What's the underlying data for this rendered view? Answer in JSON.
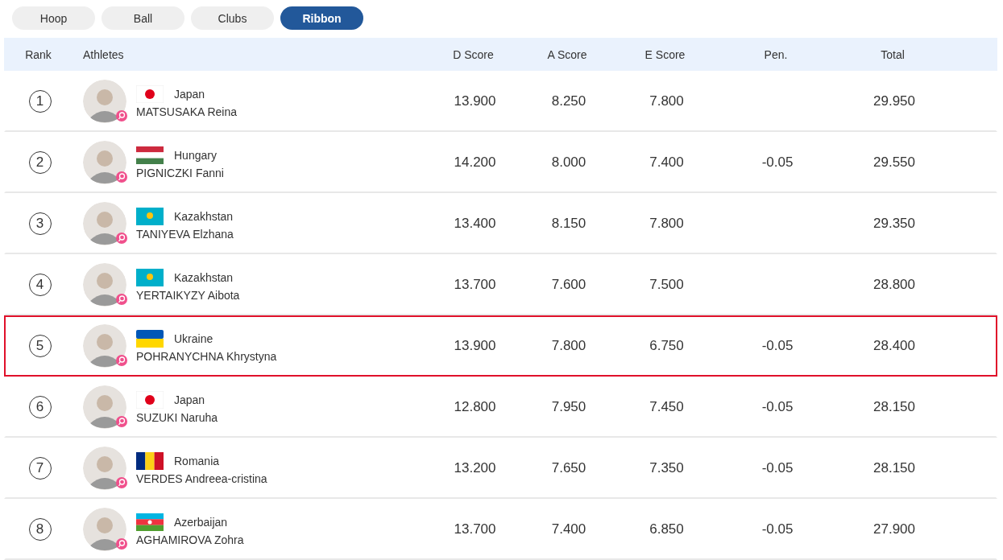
{
  "tabs": [
    {
      "label": "Hoop",
      "selected": false
    },
    {
      "label": "Ball",
      "selected": false
    },
    {
      "label": "Clubs",
      "selected": false
    },
    {
      "label": "Ribbon",
      "selected": true
    }
  ],
  "table": {
    "columns": [
      "Rank",
      "Athletes",
      "D Score",
      "A Score",
      "E Score",
      "Pen.",
      "Total"
    ],
    "rows": [
      {
        "rank": "1",
        "country": "Japan",
        "flag": {
          "kind": "japan"
        },
        "name": "MATSUSAKA Reina",
        "d_score": "13.900",
        "a_score": "8.250",
        "e_score": "7.800",
        "total": "29.950",
        "selected": false
      },
      {
        "rank": "2",
        "country": "Hungary",
        "flag": {
          "kind": "hungary"
        },
        "name": "PIGNICZKI Fanni",
        "d_score": "14.200",
        "a_score": "8.000",
        "e_score": "7.400",
        "penalty": "-0.05",
        "total": "29.550",
        "selected": false
      },
      {
        "rank": "3",
        "country": "Kazakhstan",
        "flag": {
          "kind": "kazakhstan"
        },
        "name": "TANIYEVA Elzhana",
        "d_score": "13.400",
        "a_score": "8.150",
        "e_score": "7.800",
        "total": "29.350",
        "selected": false
      },
      {
        "rank": "4",
        "country": "Kazakhstan",
        "flag": {
          "kind": "kazakhstan"
        },
        "name": "YERTAIKYZY Aibota",
        "d_score": "13.700",
        "a_score": "7.600",
        "e_score": "7.500",
        "total": "28.800",
        "selected": false
      },
      {
        "rank": "5",
        "country": "Ukraine",
        "flag": {
          "kind": "ukraine"
        },
        "name": "POHRANYCHNA Khrystyna",
        "d_score": "13.900",
        "a_score": "7.800",
        "e_score": "6.750",
        "penalty": "-0.05",
        "total": "28.400",
        "selected": true
      },
      {
        "rank": "6",
        "country": "Japan",
        "flag": {
          "kind": "japan"
        },
        "name": "SUZUKI Naruha",
        "d_score": "12.800",
        "a_score": "7.950",
        "e_score": "7.450",
        "penalty": "-0.05",
        "total": "28.150",
        "selected": false
      },
      {
        "rank": "7",
        "country": "Romania",
        "flag": {
          "kind": "romania"
        },
        "name": "VERDES Andreea-cristina",
        "d_score": "13.200",
        "a_score": "7.650",
        "e_score": "7.350",
        "penalty": "-0.05",
        "total": "28.150",
        "selected": false
      },
      {
        "rank": "8",
        "country": "Azerbaijan",
        "flag": {
          "kind": "azerbaijan"
        },
        "name": "AGHAMIROVA Zohra",
        "d_score": "13.700",
        "a_score": "7.400",
        "e_score": "6.850",
        "penalty": "-0.05",
        "total": "27.900",
        "selected": false
      }
    ]
  }
}
